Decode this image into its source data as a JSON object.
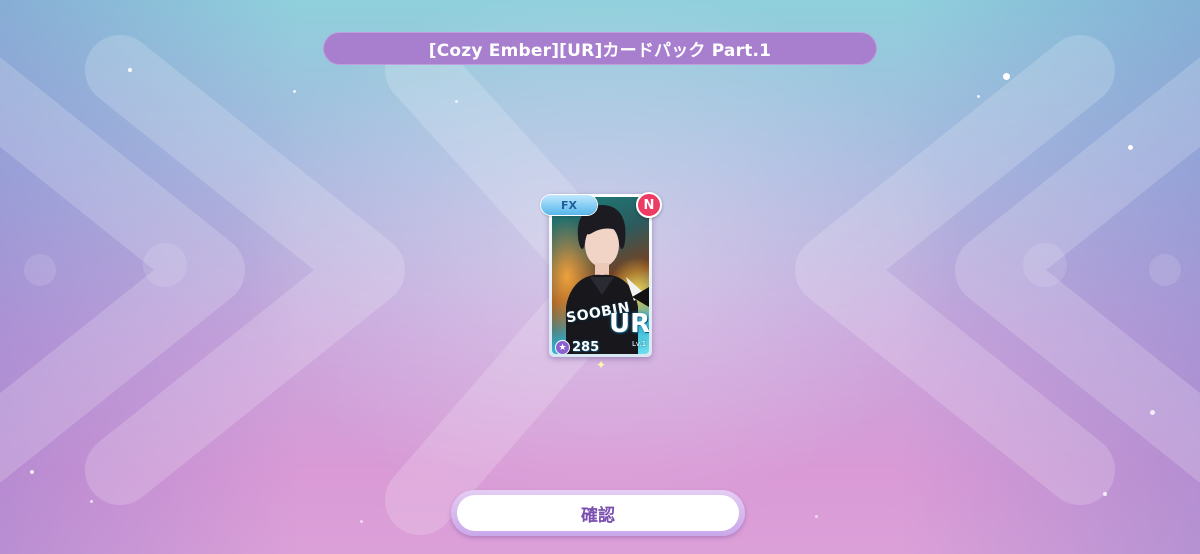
{
  "pack_title": "[Cozy Ember][UR]カードパック Part.1",
  "card": {
    "effect_badge": "FX",
    "new_badge": "N",
    "member_name": "SOOBIN",
    "rarity": "UR",
    "level": "Lv.1",
    "power": "285",
    "rank_icon": "star-icon"
  },
  "confirm_label": "確認",
  "colors": {
    "title_bar": "#a87fcf",
    "new_badge": "#ee3b63",
    "confirm_text": "#7a4fb0"
  }
}
